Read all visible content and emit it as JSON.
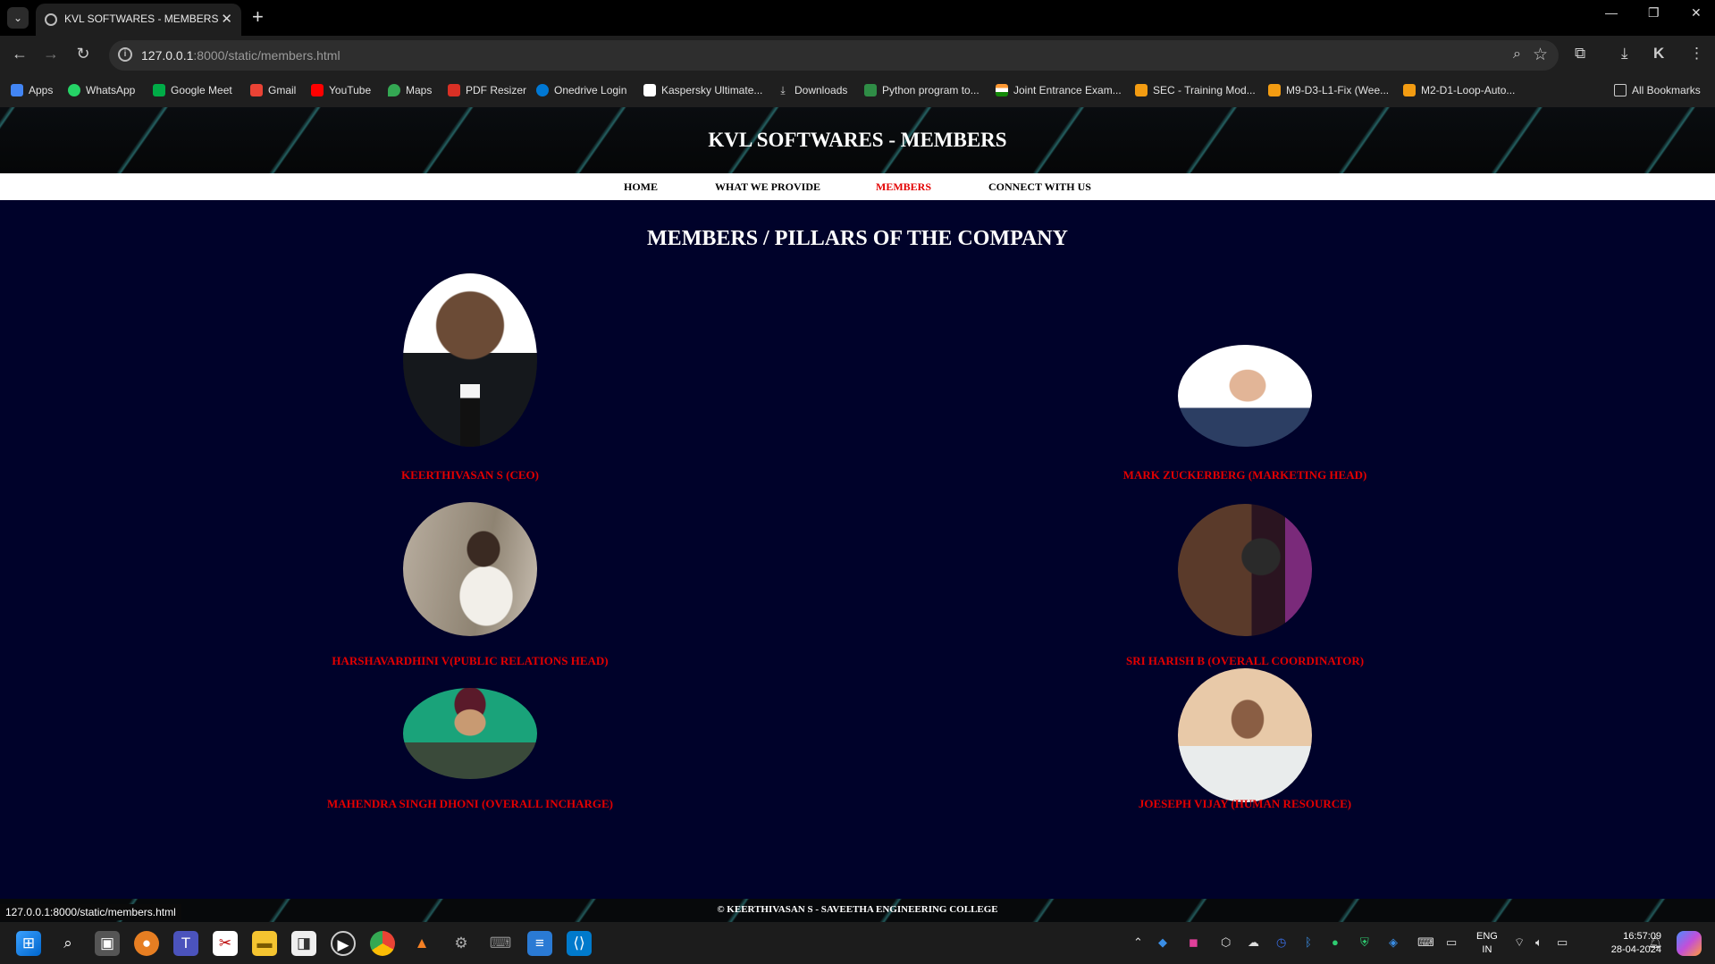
{
  "browser": {
    "tab_title": "KVL SOFTWARES - MEMBERS",
    "url_host": "127.0.0.1",
    "url_rest": ":8000/static/members.html",
    "bookmarks": [
      {
        "label": "Apps",
        "color": "#4285f4"
      },
      {
        "label": "WhatsApp",
        "color": "#25d366"
      },
      {
        "label": "Google Meet",
        "color": "#00ac47"
      },
      {
        "label": "Gmail",
        "color": "#ea4335"
      },
      {
        "label": "YouTube",
        "color": "#ff0000"
      },
      {
        "label": "Maps",
        "color": "#34a853"
      },
      {
        "label": "PDF Resizer",
        "color": "#d93025"
      },
      {
        "label": "Onedrive Login",
        "color": "#0078d4"
      },
      {
        "label": "Kaspersky Ultimate...",
        "color": "#ffffff"
      },
      {
        "label": "Downloads",
        "color": "#cccccc"
      },
      {
        "label": "Python program to...",
        "color": "#2f8d46"
      },
      {
        "label": "Joint Entrance Exam...",
        "color": "#ff9933"
      },
      {
        "label": "SEC - Training Mod...",
        "color": "#f39c12"
      },
      {
        "label": "M9-D3-L1-Fix (Wee...",
        "color": "#f39c12"
      },
      {
        "label": "M2-D1-Loop-Auto...",
        "color": "#f39c12"
      }
    ],
    "all_bookmarks": "All Bookmarks",
    "status_url": "127.0.0.1:8000/static/members.html"
  },
  "site": {
    "title": "KVL SOFTWARES - MEMBERS",
    "nav": [
      "HOME",
      "WHAT WE PROVIDE",
      "MEMBERS",
      "CONNECT WITH US"
    ],
    "active_nav": "MEMBERS",
    "heading": "MEMBERS / PILLARS OF THE COMPANY",
    "members": [
      {
        "name": "KEERTHIVASAN S (CEO)"
      },
      {
        "name": "MARK ZUCKERBERG (MARKETING HEAD)"
      },
      {
        "name": "HARSHAVARDHINI V(PUBLIC RELATIONS HEAD)"
      },
      {
        "name": "SRI HARISH B (OVERALL COORDINATOR)"
      },
      {
        "name": "MAHENDRA SINGH DHONI (OVERALL INCHARGE)"
      },
      {
        "name": "JOESEPH VIJAY (HUMAN RESOURCE)"
      }
    ],
    "footer": "© KEERTHIVASAN S - SAVEETHA ENGINEERING COLLEGE"
  },
  "taskbar": {
    "lang_top": "ENG",
    "lang_bottom": "IN",
    "time": "16:57:09",
    "date": "28-04-2024"
  }
}
